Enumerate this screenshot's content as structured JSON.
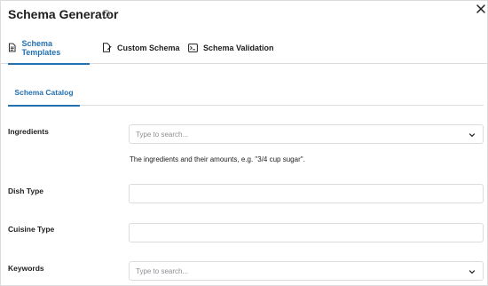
{
  "header": {
    "title": "Schema Generator",
    "help_symbol": "?",
    "close_icon": "close-icon"
  },
  "tabs": [
    {
      "label": "Schema Templates",
      "icon": "document-icon",
      "active": true
    },
    {
      "label": "Custom Schema",
      "icon": "file-edit-icon",
      "active": false
    },
    {
      "label": "Schema Validation",
      "icon": "terminal-icon",
      "active": false
    }
  ],
  "subtabs": [
    {
      "label": "Schema Catalog",
      "active": true
    }
  ],
  "fields": {
    "ingredients": {
      "label": "Ingredients",
      "placeholder": "Type to search...",
      "help": "The ingredients and their amounts, e.g. \"3/4 cup sugar\"."
    },
    "dish_type": {
      "label": "Dish Type",
      "value": ""
    },
    "cuisine_type": {
      "label": "Cuisine Type",
      "value": ""
    },
    "keywords": {
      "label": "Keywords",
      "placeholder": "Type to search..."
    }
  },
  "colors": {
    "accent": "#2271b1",
    "border": "#dcdcde",
    "placeholder": "#8c8f94",
    "text": "#1e1e1e"
  }
}
